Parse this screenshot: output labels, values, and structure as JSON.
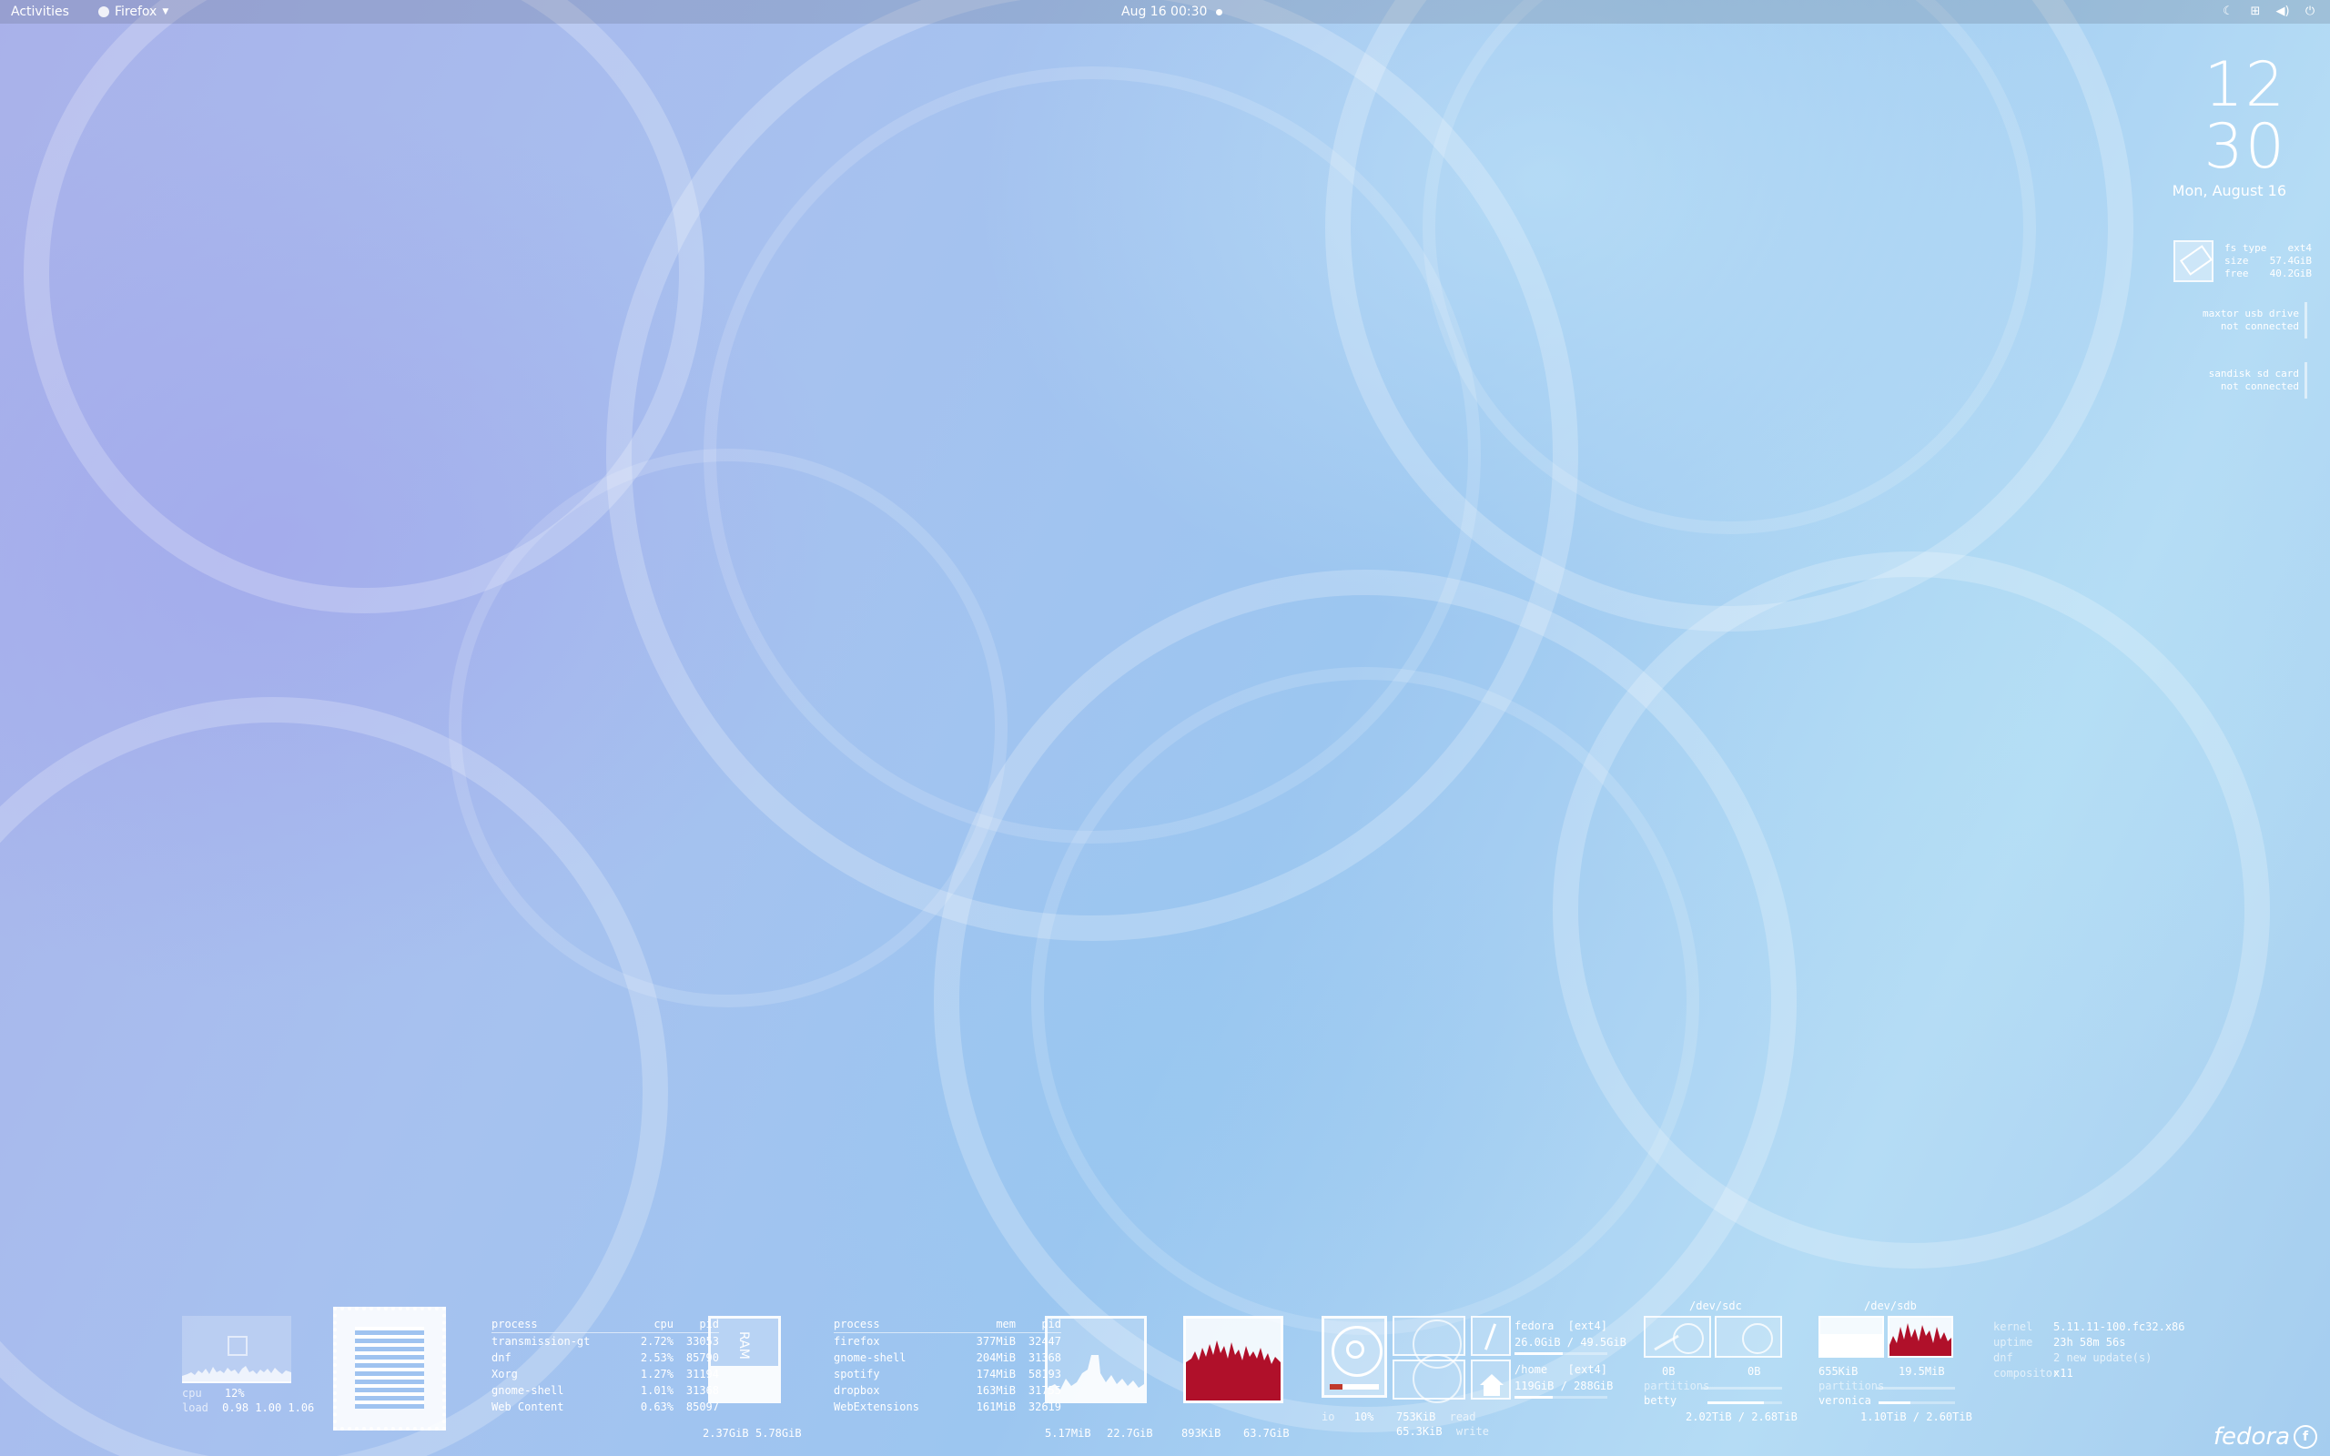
{
  "topbar": {
    "activities": "Activities",
    "app_name": "Firefox",
    "clock": "Aug 16  00:30",
    "status_icons": [
      "night-light-icon",
      "network-icon",
      "volume-icon",
      "power-icon"
    ]
  },
  "big_clock": {
    "hour": "12",
    "minute": "30",
    "date": "Mon, August 16"
  },
  "fs_widget": {
    "type_label": "fs type",
    "type_value": "ext4",
    "size_label": "size",
    "size_value": "57.4GiB",
    "free_label": "free",
    "free_value": "40.2GiB"
  },
  "drives": [
    {
      "name": "maxtor usb drive",
      "status": "not connected"
    },
    {
      "name": "sandisk sd card",
      "status": "not connected"
    }
  ],
  "cpu": {
    "label": "cpu",
    "percent": "12%",
    "load_label": "load",
    "load": "0.98 1.00 1.06"
  },
  "cpu_procs": {
    "headers": [
      "process",
      "cpu",
      "pid"
    ],
    "rows": [
      [
        "transmission-gt",
        "2.72%",
        "33053"
      ],
      [
        "dnf",
        "2.53%",
        "85790"
      ],
      [
        "Xorg",
        "1.27%",
        "31194"
      ],
      [
        "gnome-shell",
        "1.01%",
        "31368"
      ],
      [
        "Web Content",
        "0.63%",
        "85097"
      ]
    ]
  },
  "mem": {
    "used": "2.37GiB",
    "total": "5.78GiB"
  },
  "mem_procs": {
    "headers": [
      "process",
      "mem",
      "pid"
    ],
    "rows": [
      [
        "firefox",
        "377MiB",
        "32447"
      ],
      [
        "gnome-shell",
        "204MiB",
        "31368"
      ],
      [
        "spotify",
        "174MiB",
        "58193"
      ],
      [
        "dropbox",
        "163MiB",
        "31755"
      ],
      [
        "WebExtensions",
        "161MiB",
        "32619"
      ]
    ]
  },
  "net1": {
    "a": "5.17MiB",
    "b": "22.7GiB"
  },
  "net2": {
    "a": "893KiB",
    "b": "63.7GiB"
  },
  "disk": {
    "usage_label": "io",
    "usage": "10%",
    "read_value": "753KiB",
    "read_label": "read",
    "write_value": "65.3KiB",
    "write_label": "write",
    "root_name": "fedora",
    "root_fs": "[ext4]",
    "root_usage": "26.0GiB / 49.5GiB",
    "home_name": "/home",
    "home_fs": "[ext4]",
    "home_usage": "119GiB / 288GiB"
  },
  "sdc": {
    "title": "/dev/sdc",
    "left": "0B",
    "right": "0B",
    "partitions_label": "partitions",
    "part_name": "betty",
    "usage": "2.02TiB / 2.68TiB"
  },
  "sdb": {
    "title": "/dev/sdb",
    "left": "655KiB",
    "right": "19.5MiB",
    "partitions_label": "partitions",
    "part_name": "veronica",
    "usage": "1.10TiB / 2.60TiB"
  },
  "sysinfo": {
    "rows": [
      [
        "kernel",
        "5.11.11-100.fc32.x86"
      ],
      [
        "uptime",
        "23h 58m 56s"
      ],
      [
        "dnf",
        "2 new update(s)"
      ],
      [
        "compositor",
        "x11"
      ]
    ]
  },
  "logo": "fedora",
  "colors": {
    "accent_red": "#b0102a",
    "text": "#ffffff"
  }
}
